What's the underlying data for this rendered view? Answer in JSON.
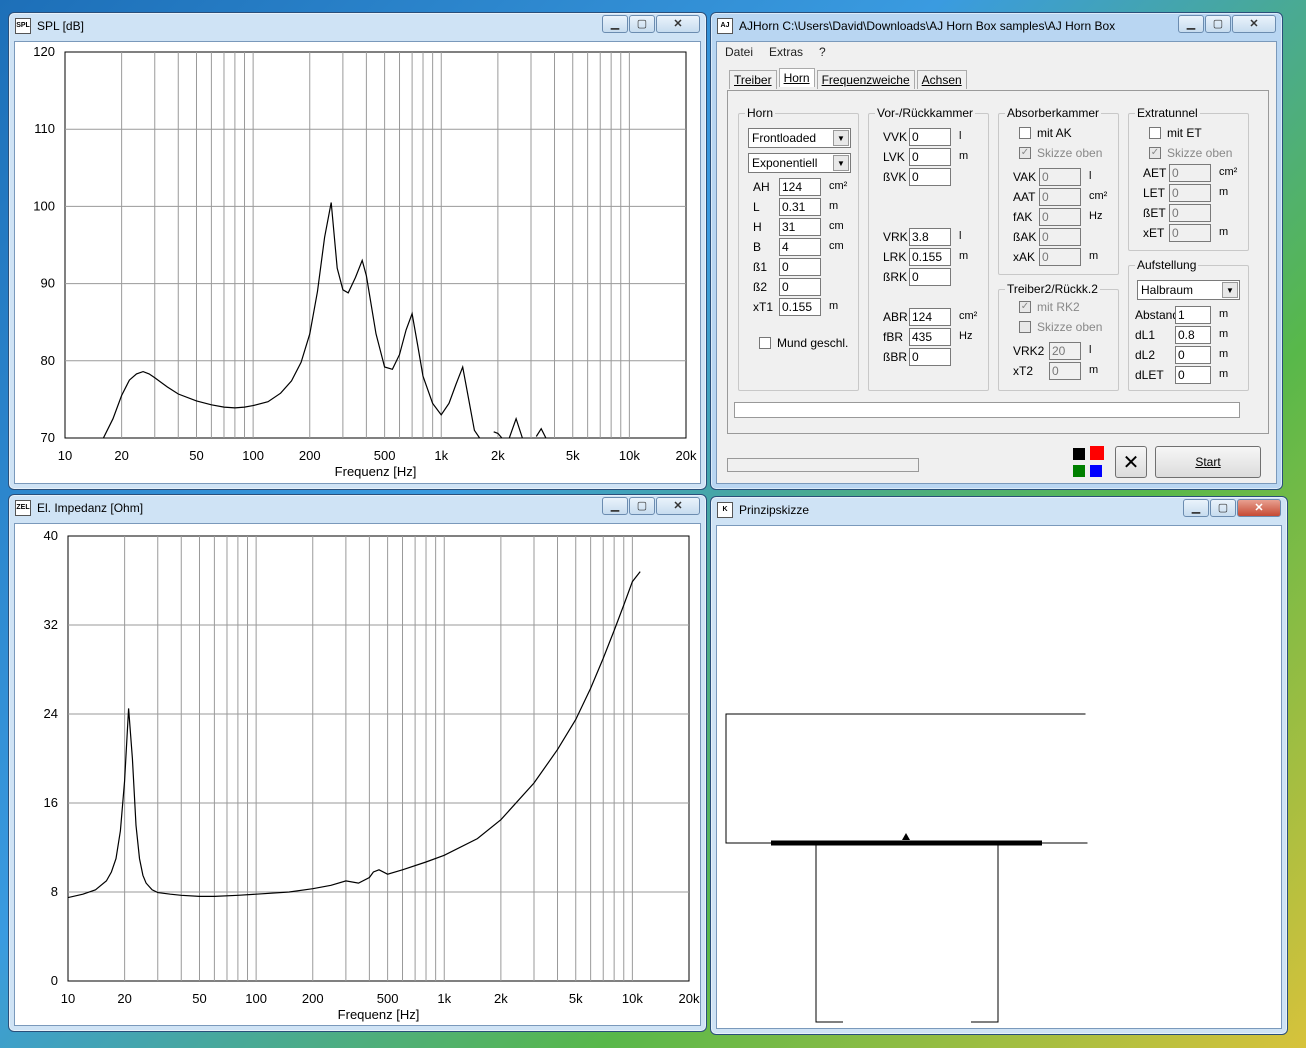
{
  "spl_window": {
    "title": "SPL [dB]",
    "icon_text": "SPL",
    "chart": {
      "type": "line",
      "y_ticks": [
        "120",
        "110",
        "100",
        "90",
        "80",
        "70"
      ],
      "x_ticks": [
        "10",
        "20",
        "50",
        "100",
        "200",
        "500",
        "1k",
        "2k",
        "5k",
        "10k",
        "20k"
      ],
      "xlabel": "Frequenz [Hz]",
      "ylim": [
        70,
        120
      ],
      "xlim": [
        10,
        20000
      ],
      "x_scale": "log",
      "grid": true,
      "x": [
        16,
        18,
        20,
        22,
        24,
        26,
        28,
        30,
        35,
        40,
        50,
        60,
        70,
        80,
        90,
        100,
        120,
        140,
        160,
        180,
        200,
        220,
        240,
        260,
        280,
        300,
        320,
        350,
        380,
        400,
        450,
        500,
        550,
        600,
        650,
        700,
        750,
        800,
        900,
        1000,
        1100,
        1200,
        1300,
        1400,
        1500,
        1600
      ],
      "values": [
        70,
        72.5,
        75.5,
        77.5,
        78.3,
        78.6,
        78.3,
        77.8,
        76.6,
        75.7,
        74.8,
        74.3,
        74.0,
        73.9,
        74.0,
        74.2,
        74.7,
        75.8,
        77.4,
        79.8,
        83.5,
        89.0,
        96.0,
        100.5,
        92.0,
        89.2,
        88.8,
        90.8,
        93.0,
        91.0,
        83.5,
        79.2,
        78.9,
        80.8,
        84.0,
        86.1,
        82.0,
        78.0,
        74.5,
        73.0,
        74.5,
        77.0,
        79.2,
        75.0,
        71.0,
        70.0
      ],
      "fragments": [
        {
          "x": [
            1900,
            2000,
            2100
          ],
          "values": [
            70.8,
            70.6,
            70.0
          ]
        },
        {
          "x": [
            2300,
            2500,
            2700
          ],
          "values": [
            70.0,
            72.5,
            70.0
          ]
        },
        {
          "x": [
            3200,
            3400,
            3600
          ],
          "values": [
            70.2,
            71.2,
            70.0
          ]
        }
      ],
      "line_color": "#000000"
    }
  },
  "impedance_window": {
    "title": "El. Impedanz [Ohm]",
    "icon_text": "ZEL",
    "chart": {
      "type": "line",
      "y_ticks": [
        "40",
        "32",
        "24",
        "16",
        "8",
        "0"
      ],
      "x_ticks": [
        "10",
        "20",
        "50",
        "100",
        "200",
        "500",
        "1k",
        "2k",
        "5k",
        "10k",
        "20k"
      ],
      "xlabel": "Frequenz [Hz]",
      "ylim": [
        0,
        40
      ],
      "xlim": [
        10,
        20000
      ],
      "x_scale": "log",
      "grid": true,
      "x": [
        10,
        12,
        14,
        16,
        17,
        18,
        19,
        20,
        21,
        22,
        23,
        24,
        25,
        26,
        28,
        30,
        35,
        40,
        50,
        60,
        80,
        100,
        150,
        200,
        250,
        300,
        350,
        400,
        420,
        450,
        500,
        600,
        800,
        1000,
        1500,
        2000,
        3000,
        4000,
        5000,
        6000,
        7000,
        8000,
        9000,
        10000,
        11000
      ],
      "values": [
        7.5,
        7.8,
        8.2,
        9.0,
        9.8,
        11.0,
        13.5,
        18.0,
        24.5,
        20.0,
        14.0,
        11.0,
        9.5,
        8.8,
        8.2,
        7.95,
        7.8,
        7.7,
        7.6,
        7.6,
        7.7,
        7.8,
        8.0,
        8.3,
        8.6,
        9.0,
        8.8,
        9.3,
        9.8,
        10.0,
        9.6,
        10.0,
        10.7,
        11.3,
        12.8,
        14.5,
        17.8,
        20.8,
        23.5,
        26.3,
        29.0,
        31.5,
        33.8,
        35.9,
        36.8
      ],
      "line_color": "#000000"
    }
  },
  "sketch_window": {
    "title": "Prinzipskizze",
    "icon_text": "K"
  },
  "main_window": {
    "title": "AJHorn  C:\\Users\\David\\Downloads\\AJ Horn Box samples\\AJ Horn Box samples\\...",
    "icon_text": "AJ",
    "menu": [
      "Datei",
      "Extras",
      "?"
    ],
    "tabs": [
      "Treiber",
      "Horn",
      "Frequenzweiche",
      "Achsen"
    ],
    "active_tab": "Horn",
    "horn": {
      "title": "Horn",
      "type_value": "Frontloaded",
      "profile_value": "Exponentiell",
      "fields": [
        {
          "label": "AH",
          "value": "124",
          "unit": "cm²"
        },
        {
          "label": "L",
          "value": "0.31",
          "unit": "m"
        },
        {
          "label": "H",
          "value": "31",
          "unit": "cm"
        },
        {
          "label": "B",
          "value": "4",
          "unit": "cm"
        },
        {
          "label": "ß1",
          "value": "0",
          "unit": ""
        },
        {
          "label": "ß2",
          "value": "0",
          "unit": ""
        },
        {
          "label": "xT1",
          "value": "0.155",
          "unit": "m"
        }
      ],
      "mund_label": "Mund geschl."
    },
    "vor": {
      "title": "Vor-/Rückkammer",
      "fields_top": [
        {
          "label": "VVK",
          "value": "0",
          "unit": "l"
        },
        {
          "label": "LVK",
          "value": "0",
          "unit": "m"
        },
        {
          "label": "ßVK",
          "value": "0",
          "unit": ""
        }
      ],
      "fields_mid": [
        {
          "label": "VRK",
          "value": "3.8",
          "unit": "l"
        },
        {
          "label": "LRK",
          "value": "0.155",
          "unit": "m"
        },
        {
          "label": "ßRK",
          "value": "0",
          "unit": ""
        }
      ],
      "fields_bot": [
        {
          "label": "ABR",
          "value": "124",
          "unit": "cm²"
        },
        {
          "label": "fBR",
          "value": "435",
          "unit": "Hz"
        },
        {
          "label": "ßBR",
          "value": "0",
          "unit": ""
        }
      ]
    },
    "absorber": {
      "title": "Absorberkammer",
      "chk_mit": "mit AK",
      "chk_skizze": "Skizze oben",
      "fields": [
        {
          "label": "VAK",
          "value": "0",
          "unit": "l"
        },
        {
          "label": "AAT",
          "value": "0",
          "unit": "cm²"
        },
        {
          "label": "fAK",
          "value": "0",
          "unit": "Hz"
        },
        {
          "label": "ßAK",
          "value": "0",
          "unit": ""
        },
        {
          "label": "xAK",
          "value": "0",
          "unit": "m"
        }
      ]
    },
    "treiber2": {
      "title": "Treiber2/Rückk.2",
      "chk_mit": "mit RK2",
      "chk_skizze": "Skizze oben",
      "fields": [
        {
          "label": "VRK2",
          "value": "20",
          "unit": "l"
        },
        {
          "label": "xT2",
          "value": "0",
          "unit": "m"
        }
      ]
    },
    "extratunnel": {
      "title": "Extratunnel",
      "chk_mit": "mit ET",
      "chk_skizze": "Skizze oben",
      "fields": [
        {
          "label": "AET",
          "value": "0",
          "unit": "cm²"
        },
        {
          "label": "LET",
          "value": "0",
          "unit": "m"
        },
        {
          "label": "ßET",
          "value": "0",
          "unit": ""
        },
        {
          "label": "xET",
          "value": "0",
          "unit": "m"
        }
      ]
    },
    "aufstellung": {
      "title": "Aufstellung",
      "value": "Halbraum",
      "fields": [
        {
          "label": "Abstand",
          "value": "1",
          "unit": "m"
        },
        {
          "label": "dL1",
          "value": "0.8",
          "unit": "m"
        },
        {
          "label": "dL2",
          "value": "0",
          "unit": "m"
        },
        {
          "label": "dLET",
          "value": "0",
          "unit": "m"
        }
      ]
    },
    "start_label": "Start",
    "cancel_symbol": "✕",
    "colors": [
      "#000000",
      "#ff0000",
      "#008000",
      "#0000ff"
    ]
  }
}
